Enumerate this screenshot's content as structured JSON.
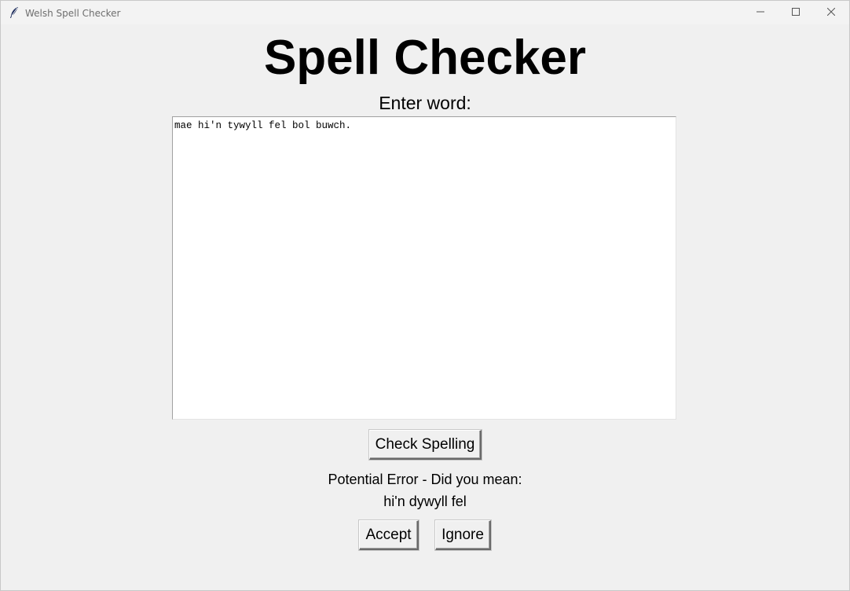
{
  "window": {
    "title": "Welsh Spell Checker",
    "icon": "feather-icon",
    "controls": [
      "minimize-icon",
      "maximize-icon",
      "close-icon"
    ]
  },
  "main": {
    "heading": "Spell Checker",
    "prompt": "Enter word:",
    "input_text": "mae hi'n tywyll fel bol buwch.",
    "check_button_label": "Check Spelling",
    "result_label": "Potential Error - Did you mean:",
    "suggestion": "hi'n dywyll fel",
    "accept_button_label": "Accept",
    "ignore_button_label": "Ignore"
  }
}
